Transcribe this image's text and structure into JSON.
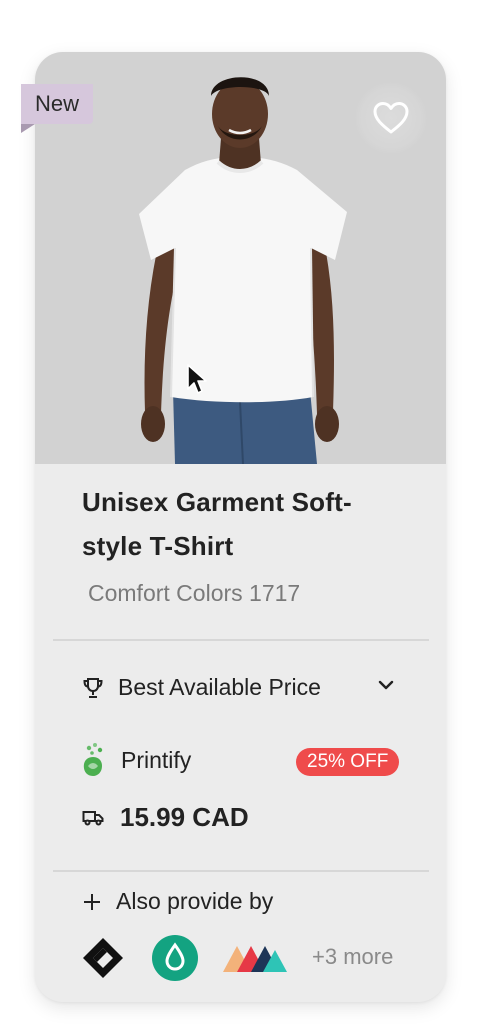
{
  "product": {
    "badge": "New",
    "title": "Unisex Garment Soft-style T-Shirt",
    "title_line1": "Unisex Garment Soft-",
    "title_line2": "style T-Shirt",
    "subtitle": "Comfort Colors 1717"
  },
  "pricing": {
    "best_price_label": "Best Available Price",
    "vendor_name": "Printify",
    "discount_label": "25% OFF",
    "price": "15.99 CAD"
  },
  "providers": {
    "header": "Also provide by",
    "more_label": "+3 more",
    "icons": [
      "diamond-logo-icon",
      "drop-logo-icon",
      "triangles-logo-icon"
    ]
  },
  "icons": {
    "favorite": "heart-icon",
    "best_price": "trophy-icon",
    "expand": "chevron-down-icon",
    "vendor": "printify-logo-icon",
    "shipping": "truck-icon",
    "add": "plus-icon",
    "cursor": "mouse-cursor-icon"
  },
  "colors": {
    "card_bg": "#ececec",
    "image_bg": "#d2d2d2",
    "badge_bg": "#d6c7dc",
    "discount_bg": "#ef4b4b",
    "printify_green": "#4caf50",
    "drop_logo_bg": "#13a381"
  }
}
